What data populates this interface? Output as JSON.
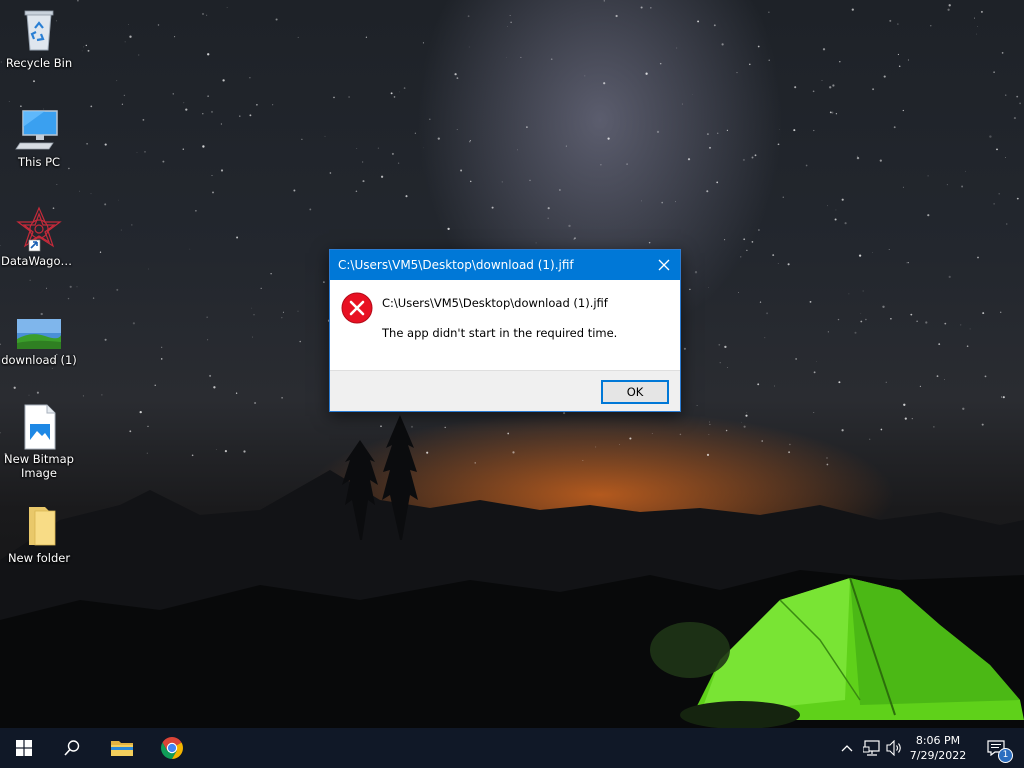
{
  "desktop": {
    "icons": [
      {
        "label": "Recycle Bin",
        "icon": "recycle-bin-icon"
      },
      {
        "label": "This PC",
        "icon": "monitor-icon"
      },
      {
        "label": "DataWagon...",
        "icon": "datawagon-shortcut-icon"
      },
      {
        "label": "download (1)",
        "icon": "image-thumbnail-icon"
      },
      {
        "label": "New Bitmap Image",
        "icon": "bitmap-file-icon"
      },
      {
        "label": "New folder",
        "icon": "folder-icon"
      }
    ]
  },
  "dialog": {
    "title": "C:\\Users\\VM5\\Desktop\\download (1).jfif",
    "path": "C:\\Users\\VM5\\Desktop\\download (1).jfif",
    "message": "The app didn't start in the required time.",
    "ok_label": "OK",
    "icon": "error-icon"
  },
  "taskbar": {
    "pinned": [
      "windows-start-icon",
      "search-icon",
      "file-explorer-icon",
      "chrome-icon"
    ],
    "tray": [
      "chevron-up-icon",
      "network-icon",
      "volume-icon"
    ],
    "time": "8:06 PM",
    "date": "7/29/2022",
    "notification_count": "1"
  },
  "colors": {
    "accent": "#0078d7",
    "taskbar": "#101827",
    "error": "#e81123"
  }
}
